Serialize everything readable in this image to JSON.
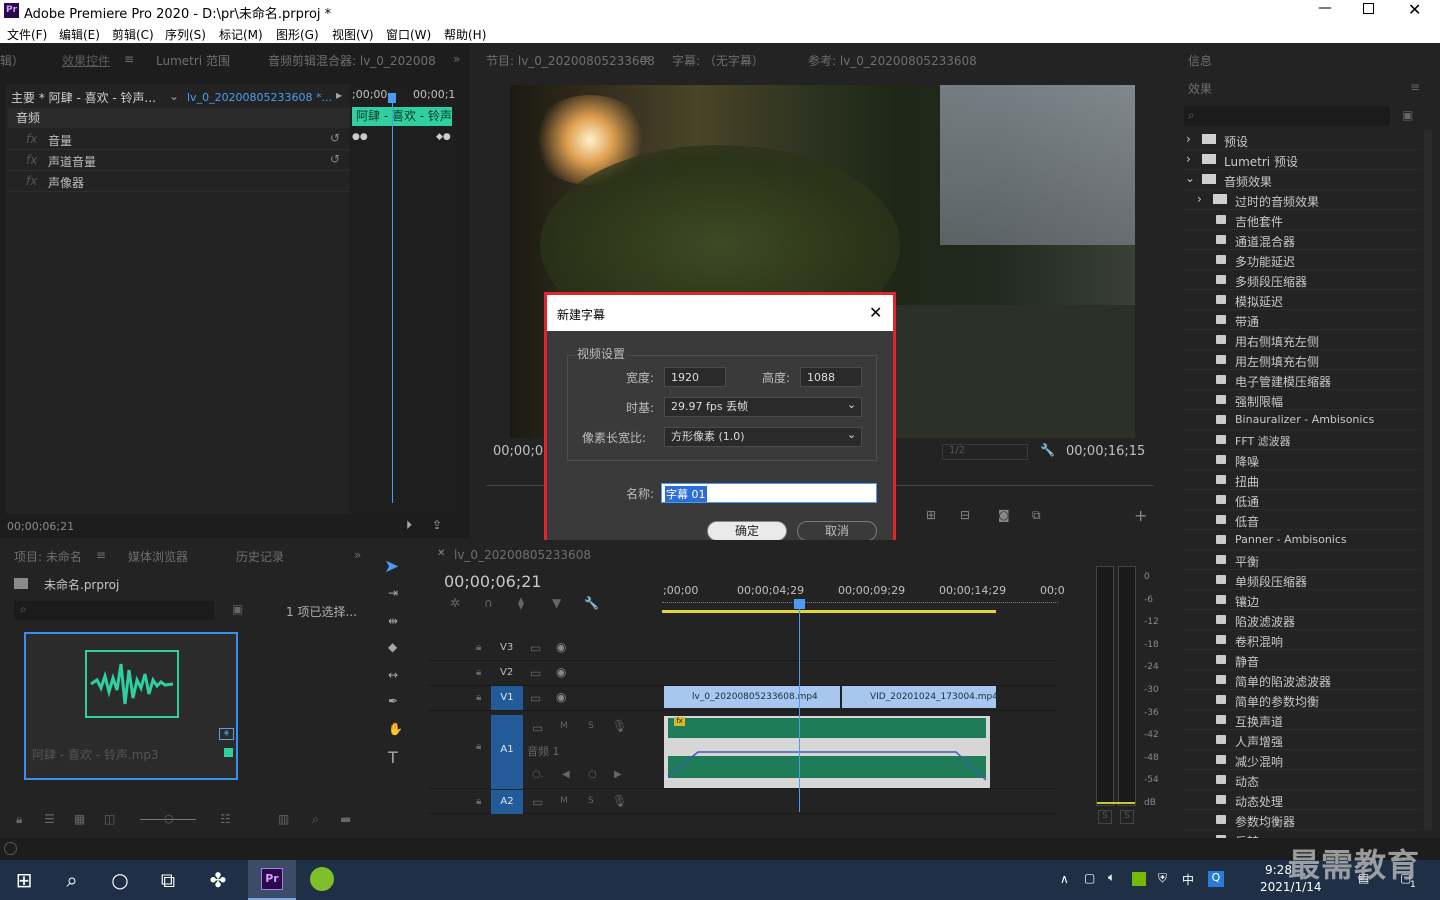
{
  "window": {
    "title": "Adobe Premiere Pro 2020 - D:\\pr\\未命名.prproj *",
    "app_icon": "Pr"
  },
  "menu": [
    "文件(F)",
    "编辑(E)",
    "剪辑(C)",
    "序列(S)",
    "标记(M)",
    "图形(G)",
    "视图(V)",
    "窗口(W)",
    "帮助(H)"
  ],
  "effect_controls": {
    "tabs": [
      "辑）",
      "效果控件",
      "Lumetri 范围",
      "音频剪辑混合器: lv_0_202008"
    ],
    "source_label": "主要 * 阿肆 - 喜欢 - 铃声...",
    "clip_label": "lv_0_20200805233608 *...",
    "timecodes": [
      ";00;00",
      "00;00;1"
    ],
    "clip_bar": "阿肆 - 喜欢 - 铃声",
    "section": "音频",
    "rows": [
      "音量",
      "声道音量",
      "声像器"
    ],
    "current_time": "00;00;06;21"
  },
  "program": {
    "tabs": [
      "节目: lv_0_20200805233608",
      "字幕: （无字幕）",
      "参考: lv_0_20200805233608"
    ],
    "left_time": "00;00;0",
    "right_time": "00;00;16;15",
    "quality": "1/2"
  },
  "dialog": {
    "title": "新建字幕",
    "group": "视频设置",
    "width_label": "宽度:",
    "width_value": "1920",
    "height_label": "高度:",
    "height_value": "1088",
    "timebase_label": "时基:",
    "timebase_value": "29.97 fps 丢帧",
    "par_label": "像素长宽比:",
    "par_value": "方形像素 (1.0)",
    "name_label": "名称:",
    "name_value": "字幕 01",
    "ok": "确定",
    "cancel": "取消"
  },
  "project": {
    "tabs": [
      "项目: 未命名",
      "媒体浏览器",
      "历史记录"
    ],
    "file": "未命名.prproj",
    "selection": "1 项已选择...",
    "item_label": "阿肆 - 喜欢 - 铃声.mp3"
  },
  "timeline": {
    "tab": "lv_0_20200805233608",
    "timecode": "00;00;06;21",
    "ruler": [
      ";00;00",
      "00;00;04;29",
      "00;00;09;29",
      "00;00;14;29",
      "00;0"
    ],
    "tracks": [
      "V3",
      "V2",
      "V1",
      "A1",
      "A2"
    ],
    "audio_name": "音频 1",
    "clips": [
      "lv_0_20200805233608.mp4",
      "VID_20201024_173004.mp4"
    ]
  },
  "meter": {
    "scale": [
      "0",
      "-6",
      "-12",
      "-18",
      "-24",
      "-30",
      "-36",
      "-42",
      "-48",
      "-54",
      "dB"
    ],
    "buttons": [
      "S",
      "S"
    ]
  },
  "effects": {
    "tabs": [
      "信息",
      "效果"
    ],
    "folders": [
      "预设",
      "Lumetri 预设",
      "音频效果",
      "过时的音频效果"
    ],
    "items": [
      "吉他套件",
      "通道混合器",
      "多功能延迟",
      "多频段压缩器",
      "模拟延迟",
      "带通",
      "用右侧填充左侧",
      "用左侧填充右侧",
      "电子管建模压缩器",
      "强制限幅",
      "Binauralizer - Ambisonics",
      "FFT 滤波器",
      "降噪",
      "扭曲",
      "低通",
      "低音",
      "Panner - Ambisonics",
      "平衡",
      "单频段压缩器",
      "镶边",
      "陷波滤波器",
      "卷积混响",
      "静音",
      "简单的陷波滤波器",
      "简单的参数均衡",
      "互换声道",
      "人声增强",
      "减少混响",
      "动态",
      "动态处理",
      "参数均衡器",
      "反转"
    ]
  },
  "taskbar": {
    "time": "9:28",
    "date": "2021/1/14",
    "ime": "中",
    "watermark": "最需教育",
    "notify": "1"
  }
}
